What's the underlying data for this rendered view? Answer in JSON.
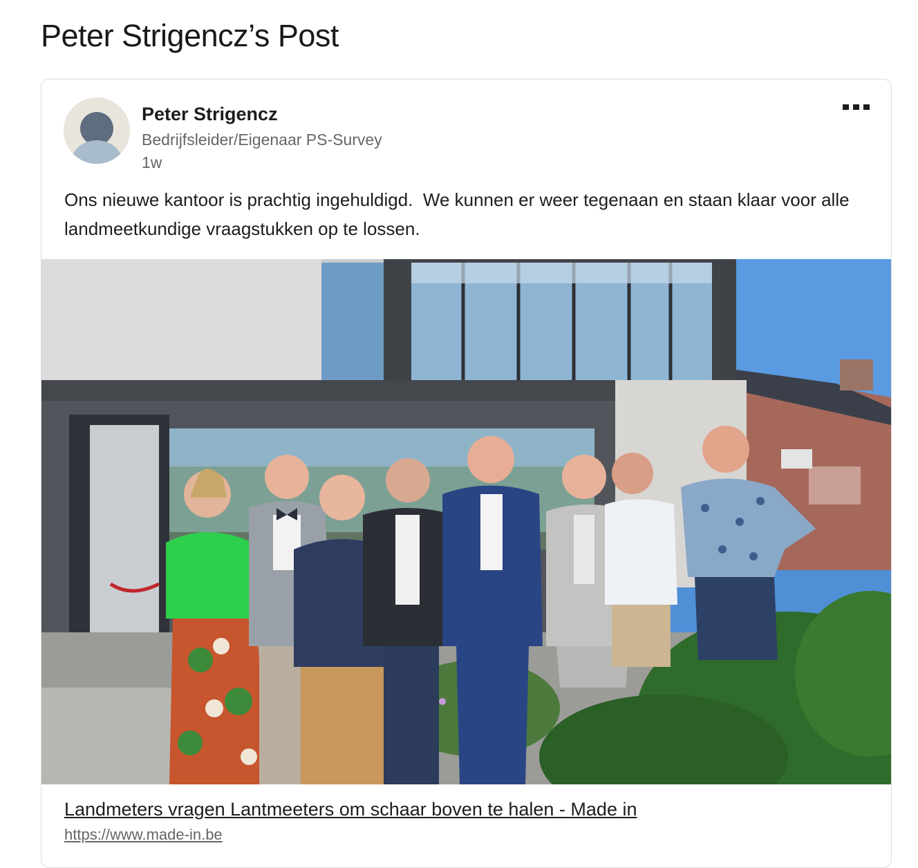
{
  "page": {
    "title": "Peter Strigencz’s Post"
  },
  "post": {
    "author": {
      "name": "Peter Strigencz",
      "headline": "Bedrijfsleider/Eigenaar PS-Survey",
      "avatar_icon": "person-placeholder-icon"
    },
    "time": "1w",
    "more_icon": "ellipsis-icon",
    "text": "Ons nieuwe kantoor is prachtig ingehuldigd.  We kunnen er weer tegenaan en staan klaar voor alle landmeetkundige vraagstukken op te lossen.",
    "link": {
      "title": "Landmeters vragen Lantmeeters om schaar boven te halen - Made in",
      "url": "https://www.made-in.be"
    }
  },
  "colors": {
    "accent_link": "#1d1d1d",
    "muted": "#666666",
    "border": "#dcdcdc"
  }
}
